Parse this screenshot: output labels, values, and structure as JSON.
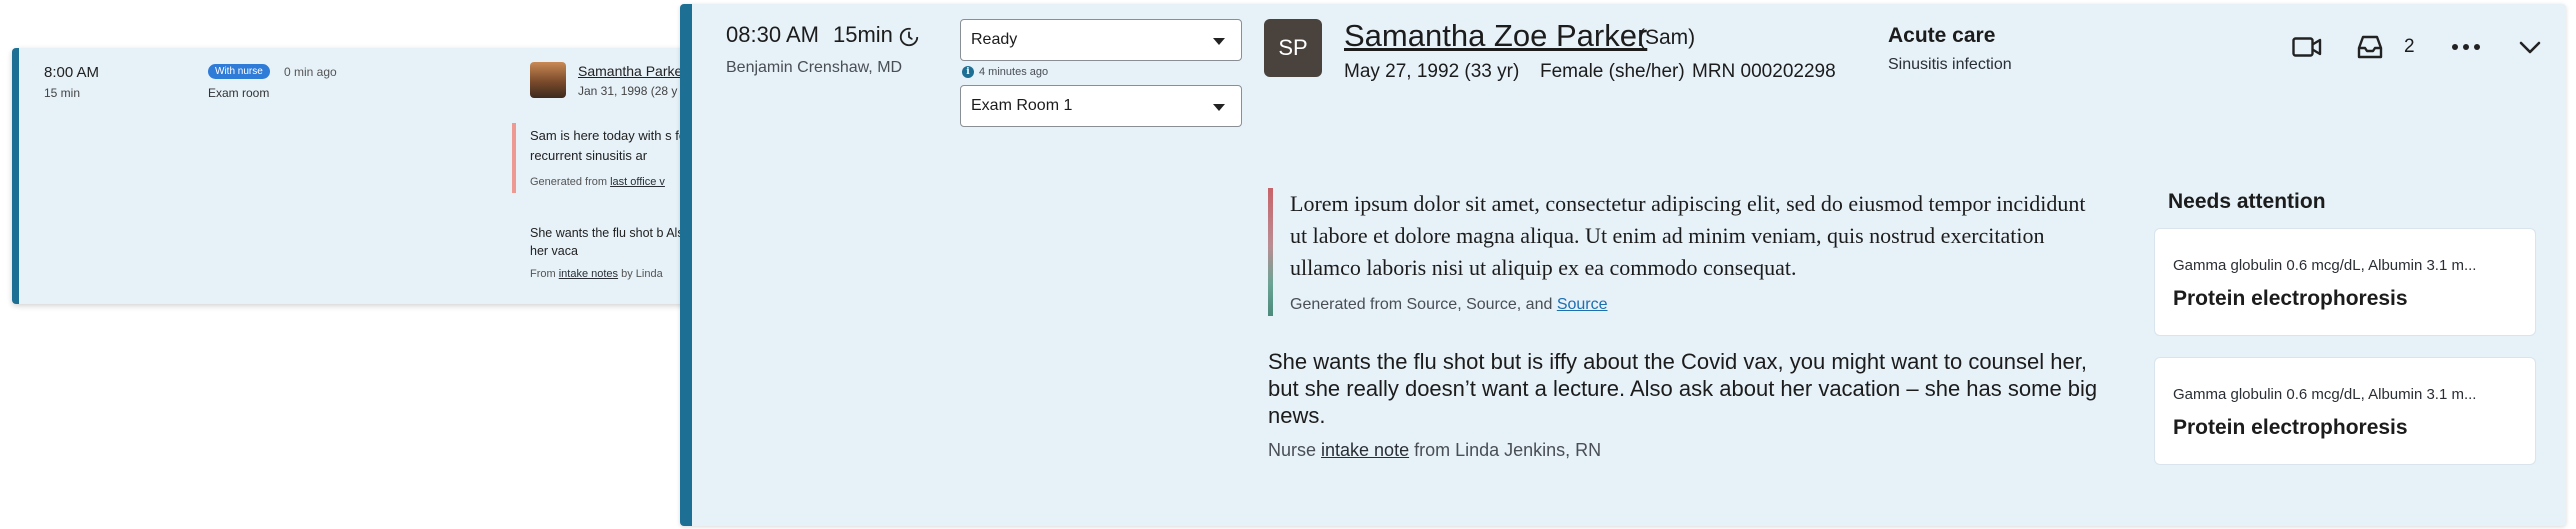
{
  "small_card": {
    "time": "8:00 AM",
    "duration": "15 min",
    "badge": "With nurse",
    "status_ago": "0 min ago",
    "room": "Exam room",
    "patient_name": "Samantha Parker",
    "dob": "Jan 31, 1998 (28 y",
    "summary": "Sam is here today with s for recurrent sinusitis ar",
    "generated_prefix": "Generated from ",
    "generated_link": "last office v",
    "note": "She wants the flu shot b Also ask about her vaca",
    "from_prefix": "From ",
    "from_link": "intake notes",
    "from_suffix": " by Linda"
  },
  "large_card": {
    "time": "08:30 AM",
    "duration": "15min",
    "provider": "Benjamin Crenshaw, MD",
    "status_select": "Ready",
    "status_updated": "4 minutes ago",
    "room_select": "Exam Room 1",
    "avatar_initials": "SP",
    "patient_name": "Samantha Zoe Parker",
    "preferred_name": "(Sam)",
    "dob": "May 27, 1992 (33 yr)",
    "sex": "Female (she/her)",
    "mrn": "MRN 000202298",
    "care_type": "Acute care",
    "visit_reason": "Sinusitis infection",
    "inbox_count": "2",
    "summary": "Lorem ipsum dolor sit amet, consectetur adipiscing elit, sed do eiusmod tempor incididunt ut labore et dolore magna aliqua. Ut enim ad minim veniam, quis nostrud exercitation ullamco laboris nisi ut aliquip ex ea commodo consequat.",
    "generated_prefix": "Generated from Source, Source, and ",
    "generated_link": "Source",
    "note": "She wants the flu shot but is iffy about the Covid vax, you might want to counsel her, but she really doesn’t want a lecture. Also ask about her vacation – she has some big news.",
    "nurse_prefix": "Nurse ",
    "nurse_link": "intake note",
    "nurse_suffix": " from Linda Jenkins, RN",
    "needs_attention": {
      "title": "Needs attention",
      "items": [
        {
          "lab": "Gamma globulin 0.6 mcg/dL, Albumin 3.1 m...",
          "test": "Protein electrophoresis"
        },
        {
          "lab": "Gamma globulin 0.6 mcg/dL, Albumin 3.1 m...",
          "test": "Protein electrophoresis"
        }
      ]
    }
  },
  "icons": [
    "video-icon",
    "inbox-icon",
    "more-icon",
    "chevron-down-icon",
    "clock-icon",
    "info-icon"
  ],
  "colors": {
    "accent": "#1e6f94",
    "card_bg": "#e6f1f8",
    "badge": "#2f7bd8",
    "link": "#1e6fb0"
  }
}
